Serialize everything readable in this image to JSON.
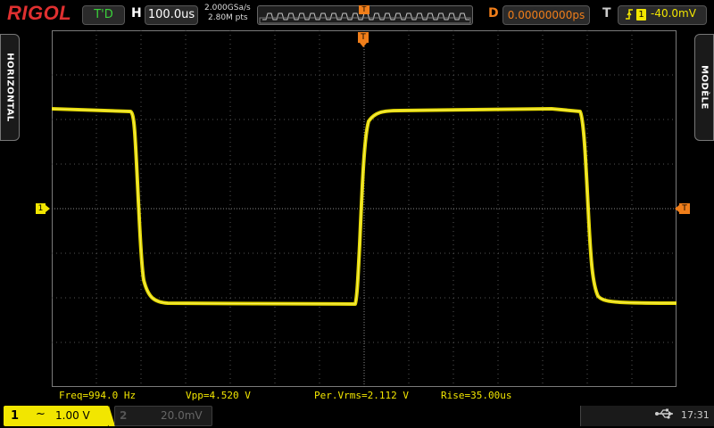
{
  "brand": "RIGOL",
  "top": {
    "run_state": "T'D",
    "hbase_label": "H",
    "hbase_value": "100.0us",
    "sample_rate": "2.000GSa/s",
    "memory_depth": "2.80M pts",
    "delay_label": "D",
    "delay_value": "0.00000000ps",
    "trigger_label": "T",
    "trigger_source": "1",
    "trigger_level": "-40.0mV"
  },
  "side_tabs": {
    "left": "HORIZONTAL",
    "right": "MODÈLE"
  },
  "markers": {
    "ch1": "1",
    "trigger_level": "T",
    "trigger_position": "T"
  },
  "measurements": {
    "freq": "Freq=994.0 Hz",
    "vpp": "Vpp=4.520 V",
    "vrms": "Per.Vrms=2.112 V",
    "rise": "Rise=35.00us"
  },
  "bottom": {
    "ch1_num": "1",
    "ch1_coupling": "~",
    "ch1_scale": "1.00 V",
    "ch2_num": "2",
    "ch2_scale": "20.0mV",
    "clock": "17:31"
  },
  "icons": {
    "trigger_edge": "rising-edge-icon",
    "usb": "usb-icon"
  },
  "colors": {
    "ch1": "#f2e600",
    "trigger": "#f07e1a",
    "brand": "#e03030",
    "run": "#3bd23b"
  }
}
